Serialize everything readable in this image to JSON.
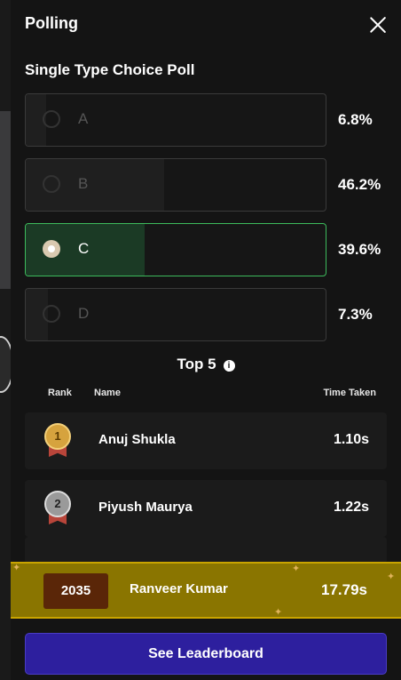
{
  "header": {
    "title": "Polling"
  },
  "poll": {
    "name": "Single Type Choice Poll",
    "options": [
      {
        "label": "A",
        "percent_text": "6.8%",
        "fill_percent": 6.8,
        "selected": false
      },
      {
        "label": "B",
        "percent_text": "46.2%",
        "fill_percent": 46.2,
        "selected": false
      },
      {
        "label": "C",
        "percent_text": "39.6%",
        "fill_percent": 39.6,
        "selected": true
      },
      {
        "label": "D",
        "percent_text": "7.3%",
        "fill_percent": 7.3,
        "selected": false
      }
    ]
  },
  "leaderboard": {
    "title": "Top 5",
    "columns": {
      "rank": "Rank",
      "name": "Name",
      "time": "Time Taken"
    },
    "rows": [
      {
        "rank": "1",
        "name": "Anuj Shukla",
        "time": "1.10s",
        "medal": "gold"
      },
      {
        "rank": "2",
        "name": "Piyush Maurya",
        "time": "1.22s",
        "medal": "silver"
      }
    ]
  },
  "me": {
    "rank": "2035",
    "name": "Ranveer Kumar",
    "time": "17.79s"
  },
  "actions": {
    "leaderboard_button": "See Leaderboard"
  },
  "colors": {
    "selected_border": "#3dbb5c",
    "my_bar": "#8a7500",
    "button": "#2d1f9e"
  }
}
